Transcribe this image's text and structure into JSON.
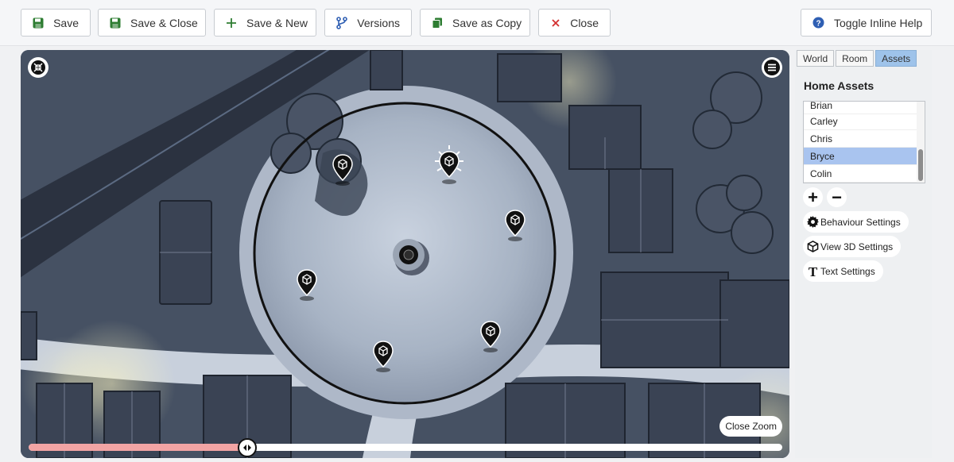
{
  "toolbar": {
    "save": "Save",
    "save_close": "Save & Close",
    "save_new": "Save & New",
    "versions": "Versions",
    "save_copy": "Save as Copy",
    "close": "Close",
    "help": "Toggle Inline Help"
  },
  "map": {
    "close_zoom": "Close Zoom",
    "slider_value_pct": 29
  },
  "side": {
    "tabs": [
      {
        "label": "World",
        "active": false
      },
      {
        "label": "Room",
        "active": false
      },
      {
        "label": "Assets",
        "active": true
      }
    ],
    "title": "Home Assets",
    "assets": [
      "Brian",
      "Carley",
      "Chris",
      "Bryce",
      "Colin"
    ],
    "selected": "Bryce",
    "add": "+",
    "remove": "−",
    "settings": {
      "behaviour": "Behaviour Settings",
      "view3d": "View 3D Settings",
      "text": "Text Settings"
    }
  },
  "colors": {
    "accent": "#9ec3ea",
    "slider_fill": "#f2a4a4",
    "save_green": "#2e7d32",
    "close_red": "#d32f2f",
    "help_blue": "#2f5fb3"
  }
}
